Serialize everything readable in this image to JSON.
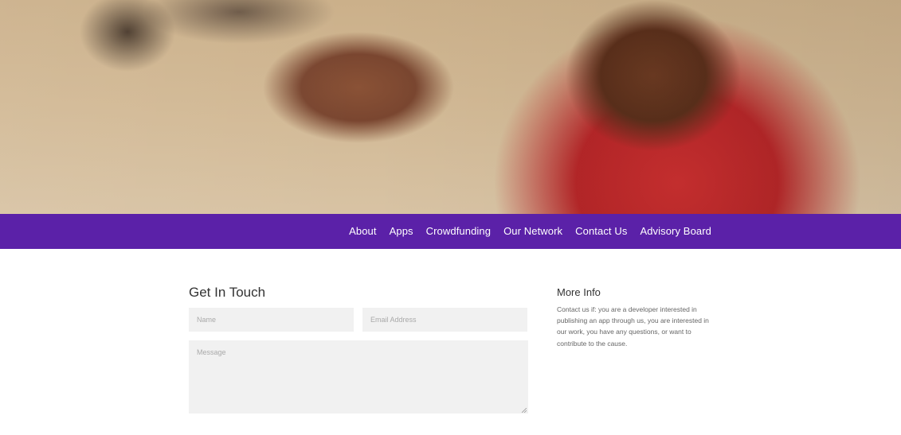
{
  "nav": {
    "items": [
      {
        "label": "About"
      },
      {
        "label": "Apps"
      },
      {
        "label": "Crowdfunding"
      },
      {
        "label": "Our Network"
      },
      {
        "label": "Contact Us"
      },
      {
        "label": "Advisory Board"
      }
    ],
    "background_color": "#5b21a8"
  },
  "contact": {
    "title": "Get In Touch",
    "name_placeholder": "Name",
    "email_placeholder": "Email Address",
    "message_placeholder": "Message"
  },
  "info": {
    "title": "More Info",
    "text": "Contact us if: you are a developer interested in publishing an app through us, you are interested in our work, you have any questions, or want to contribute to the cause."
  }
}
